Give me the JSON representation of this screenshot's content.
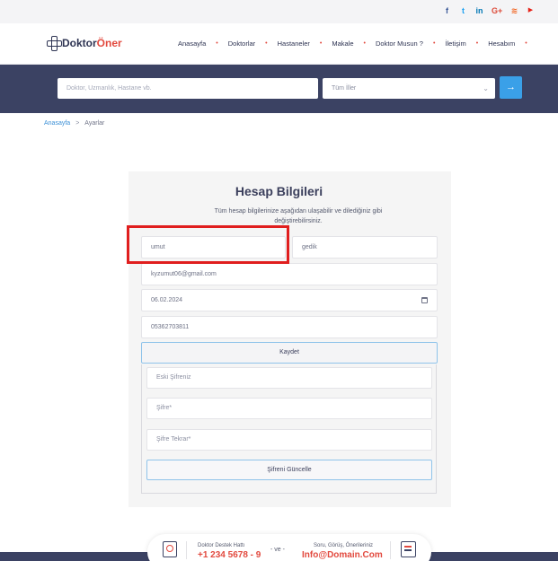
{
  "social": [
    {
      "icon": "facebook-icon",
      "glyph": "f",
      "color": "#3b5998"
    },
    {
      "icon": "twitter-icon",
      "glyph": "t",
      "color": "#1da1f2"
    },
    {
      "icon": "linkedin-icon",
      "glyph": "in",
      "color": "#0077b5"
    },
    {
      "icon": "google-plus-icon",
      "glyph": "G+",
      "color": "#dd4b39"
    },
    {
      "icon": "rss-icon",
      "glyph": "≋",
      "color": "#f26522"
    },
    {
      "icon": "youtube-icon",
      "glyph": "▶",
      "color": "#e62117"
    }
  ],
  "logo": {
    "part1": "Doktor",
    "part2": "Öner"
  },
  "nav": [
    "Anasayfa",
    "Doktorlar",
    "Hastaneler",
    "Makale",
    "Doktor Musun ?",
    "İletişim",
    "Hesabım"
  ],
  "search": {
    "placeholder": "Doktor, Uzmanlık, Hastane vb.",
    "select_value": "Tüm İller"
  },
  "breadcrumb": {
    "home": "Anasayfa",
    "separator": ">",
    "current": "Ayarlar"
  },
  "form": {
    "title": "Hesap Bilgileri",
    "description": "Tüm hesap bilgilerinize aşağıdan ulaşabilir ve dilediğiniz gibi değiştirebilirsiniz.",
    "first_name": "umut",
    "last_name": "gedik",
    "email": "kyzumut06@gmail.com",
    "birth_date": "06.02.2024",
    "phone": "05362703811",
    "save_label": "Kaydet",
    "old_password_placeholder": "Eski Şifreniz",
    "password_placeholder": "Şifre*",
    "password_repeat_placeholder": "Şifre Tekrar*",
    "update_password_label": "Şifreni Güncelle"
  },
  "footer": {
    "support_label": "Doktor Destek Hattı",
    "support_phone": "+1 234 5678 - 9",
    "connector": "- ve -",
    "feedback_label": "Soru, Görüş, Önerileriniz",
    "feedback_email": "Info@Domain.Com"
  },
  "colors": {
    "accent": "#3aa0e8",
    "brand_red": "#e2493e",
    "navy": "#3b4263",
    "highlight": "#e01e1e"
  }
}
